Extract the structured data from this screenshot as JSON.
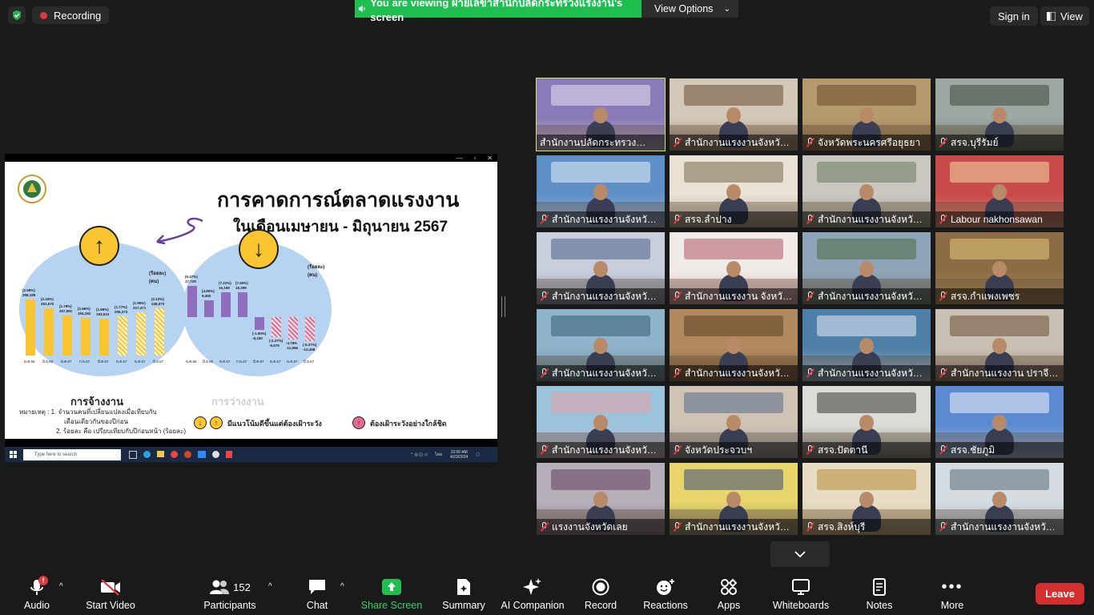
{
  "topbar": {
    "recording_label": "Recording",
    "share_banner": "You are viewing ฝ่ายเลขาสำนักปลัดกระทรวงแรงงาน's screen",
    "view_options": "View Options",
    "sign_in": "Sign in",
    "view": "View"
  },
  "slide": {
    "title": "การคาดการณ์ตลาดแรงงาน",
    "subtitle": "ในเดือนเมษายน - มิถุนายน 2567",
    "employment_title": "การจ้างงาน",
    "unemployment_title": "การว่างงาน",
    "unit_left": "(ร้อยละ)\n(คน)",
    "unit_right": "(ร้อยละ)\n(คน)",
    "note_line1": "หมายเหตุ : 1. จำนวนคนที่เปลี่ยนแปลงเมื่อเทียบกับ",
    "note_line2": "เดือนเดียวกันของปีก่อน",
    "note_line3": "2. ร้อยละ คือ เปรียบเทียบกับปีก่อนหน้า (ร้อยละ)",
    "legend_up": "มีแนวโน้มดีขึ้นแต่ต้องเฝ้าระวัง",
    "legend_down": "ต้องเฝ้าระวังอย่างใกล้ชิด",
    "employment_bars": [
      {
        "month": "พ.ค.66",
        "pct": "(2.58%)",
        "val": "298,189",
        "h": 0.78,
        "hatch": false
      },
      {
        "month": "มิ.ย.66",
        "pct": "(2.44%)",
        "val": "252,670",
        "h": 0.66,
        "hatch": false
      },
      {
        "month": "ต.ค.67",
        "pct": "(1.79%)",
        "val": "207,981",
        "h": 0.55,
        "hatch": false
      },
      {
        "month": "ก.พ.67",
        "pct": "(1.66%)",
        "val": "194,192",
        "h": 0.52,
        "hatch": false
      },
      {
        "month": "มี.ค.67",
        "pct": "(1.66%)",
        "val": "193,510",
        "h": 0.51,
        "hatch": false
      },
      {
        "month": "พ.ค.67",
        "pct": "(1.77%)",
        "val": "206,373",
        "h": 0.54,
        "hatch": true
      },
      {
        "month": "พ.ค.67",
        "pct": "(1.95%)",
        "val": "227,471",
        "h": 0.6,
        "hatch": true
      },
      {
        "month": "มิ.ย.67",
        "pct": "(2.12%)",
        "val": "248,570",
        "h": 0.65,
        "hatch": true
      }
    ],
    "unemployment_bars": [
      {
        "month": "พ.ค.66",
        "pct": "(6.47%)",
        "val": "17,729",
        "v": 0.85,
        "hatch": false
      },
      {
        "month": "มิ.ย.66",
        "pct": "(4.90%)",
        "val": "9,455",
        "v": 0.45,
        "hatch": false
      },
      {
        "month": "ต.ค.67",
        "pct": "(7.22%)",
        "val": "16,169",
        "v": 0.67,
        "hatch": false
      },
      {
        "month": "ก.พ.67",
        "pct": "(7.60%)",
        "val": "16,399",
        "v": 0.68,
        "hatch": false
      },
      {
        "month": "มี.ค.67",
        "pct": "(-1.90%)",
        "val": "-8,160",
        "v": -0.35,
        "hatch": false
      },
      {
        "month": "พ.ค.67",
        "pct": "(-2.27%)",
        "val": "-9,675",
        "v": -0.55,
        "hatch": true
      },
      {
        "month": "พ.ค.67",
        "pct": "-4.76%",
        "val": "-11,556",
        "v": -0.6,
        "hatch": true
      },
      {
        "month": "มิ.ย.67",
        "pct": "(-5.37%)",
        "val": "-13,458",
        "v": -0.65,
        "hatch": true
      }
    ],
    "taskbar_search": "Type here to search",
    "taskbar_lang": "ไทย",
    "taskbar_time": "10:06 AM",
    "taskbar_date": "4/23/2024"
  },
  "participants": [
    {
      "name": "สำนักงานปลัดกระทรวงแรงงาน",
      "muted": false,
      "active": true,
      "bg": "#8b7ab8",
      "fg": "#e8e2f0"
    },
    {
      "name": "สำนักงานแรงงานจังหวัดแม่ฮ่องสอน",
      "muted": true,
      "active": false,
      "bg": "#d4c9b8",
      "fg": "#6b4a2f"
    },
    {
      "name": "จังหวัดพระนครศรีอยุธยา",
      "muted": true,
      "active": false,
      "bg": "#b59a6e",
      "fg": "#6a4d2c"
    },
    {
      "name": "สรจ.บุรีรัมย์",
      "muted": true,
      "active": false,
      "bg": "#9ea8a2",
      "fg": "#3e4a3e"
    },
    {
      "name": "สำนักงานแรงงานจังหวัดพัทลุง",
      "muted": true,
      "active": false,
      "bg": "#5f8fc7",
      "fg": "#e6eef7"
    },
    {
      "name": "สรจ.ลำปาง",
      "muted": true,
      "active": false,
      "bg": "#e9e2d5",
      "fg": "#7a6a4e"
    },
    {
      "name": "สำนักงานแรงงานจังหวัดนครนายก",
      "muted": true,
      "active": false,
      "bg": "#c9c7c0",
      "fg": "#6c7a5e"
    },
    {
      "name": "Labour nakhonsawan",
      "muted": true,
      "active": false,
      "bg": "#c94a4a",
      "fg": "#f1d7a8"
    },
    {
      "name": "สำนักงานแรงงานจังหวัดสมุทรสาคร",
      "muted": true,
      "active": false,
      "bg": "#c8cedb",
      "fg": "#4a5f86"
    },
    {
      "name": "สำนักงานแรงงาน จังหวัดศรีสะเกษ",
      "muted": true,
      "active": false,
      "bg": "#f0ebe6",
      "fg": "#b35a6c"
    },
    {
      "name": "สำนักงานแรงงานจังหวัดสกลนคร",
      "muted": true,
      "active": false,
      "bg": "#8fa4b8",
      "fg": "#4d6b43"
    },
    {
      "name": "สรจ.กำแพงเพชร",
      "muted": true,
      "active": false,
      "bg": "#8b6c45",
      "fg": "#e6c778"
    },
    {
      "name": "สำนักงานแรงงานจังหวัดสุราษฎร์ธานี",
      "muted": true,
      "active": false,
      "bg": "#8fb3c8",
      "fg": "#355c72"
    },
    {
      "name": "สำนักงานแรงงานจังหวัดชุมพร",
      "muted": true,
      "active": false,
      "bg": "#b08a5e",
      "fg": "#5e4128"
    },
    {
      "name": "สำนักงานแรงงานจังหวัดพิษณุโลก",
      "muted": true,
      "active": false,
      "bg": "#4e7fa6",
      "fg": "#e5eef6"
    },
    {
      "name": "สำนักงานแรงงาน ปราจีนบุรี",
      "muted": true,
      "active": false,
      "bg": "#c9c0b4",
      "fg": "#6d4f36"
    },
    {
      "name": "สำนักงานแรงงานจังหวัดสระแก้ว",
      "muted": true,
      "active": false,
      "bg": "#9cc3dc",
      "fg": "#e8a0a6"
    },
    {
      "name": "จังหวัดประจวบฯ",
      "muted": true,
      "active": false,
      "bg": "#cfc4b4",
      "fg": "#5a6d8a"
    },
    {
      "name": "สรจ.ปัตตานี",
      "muted": true,
      "active": false,
      "bg": "#dcdcd6",
      "fg": "#3a3a3a"
    },
    {
      "name": "สรจ.ชัยภูมิ",
      "muted": true,
      "active": false,
      "bg": "#5b8ad1",
      "fg": "#f0f4fb"
    },
    {
      "name": "แรงงานจังหวัดเลย",
      "muted": true,
      "active": false,
      "bg": "#b6aeb8",
      "fg": "#5e3f5c"
    },
    {
      "name": "สำนักงานแรงงานจังหวัดนครพนม",
      "muted": true,
      "active": false,
      "bg": "#e8d56c",
      "fg": "#3c4a7a"
    },
    {
      "name": "สรจ.สิงห์บุรี",
      "muted": true,
      "active": false,
      "bg": "#e7dcc4",
      "fg": "#b48d3a"
    },
    {
      "name": "สำนักงานแรงงานจังหวัดหนองคาย",
      "muted": true,
      "active": false,
      "bg": "#d4dce2",
      "fg": "#5a6b78"
    }
  ],
  "toolbar": {
    "audio": "Audio",
    "video": "Start Video",
    "participants": "Participants",
    "participants_count": "152",
    "chat": "Chat",
    "share": "Share Screen",
    "summary": "Summary",
    "ai": "AI Companion",
    "record": "Record",
    "reactions": "Reactions",
    "apps": "Apps",
    "whiteboards": "Whiteboards",
    "notes": "Notes",
    "more": "More",
    "leave": "Leave",
    "audio_badge": "!"
  },
  "colors": {
    "share_green": "#1ebe4f",
    "leave_red": "#d42f2f",
    "active_speaker": "#d7e44b",
    "chart_yellow": "#f9c531",
    "chart_purple": "#8f6fbd",
    "chart_pink": "#e36b8f",
    "ellipse_blue": "#b6d3f2"
  }
}
